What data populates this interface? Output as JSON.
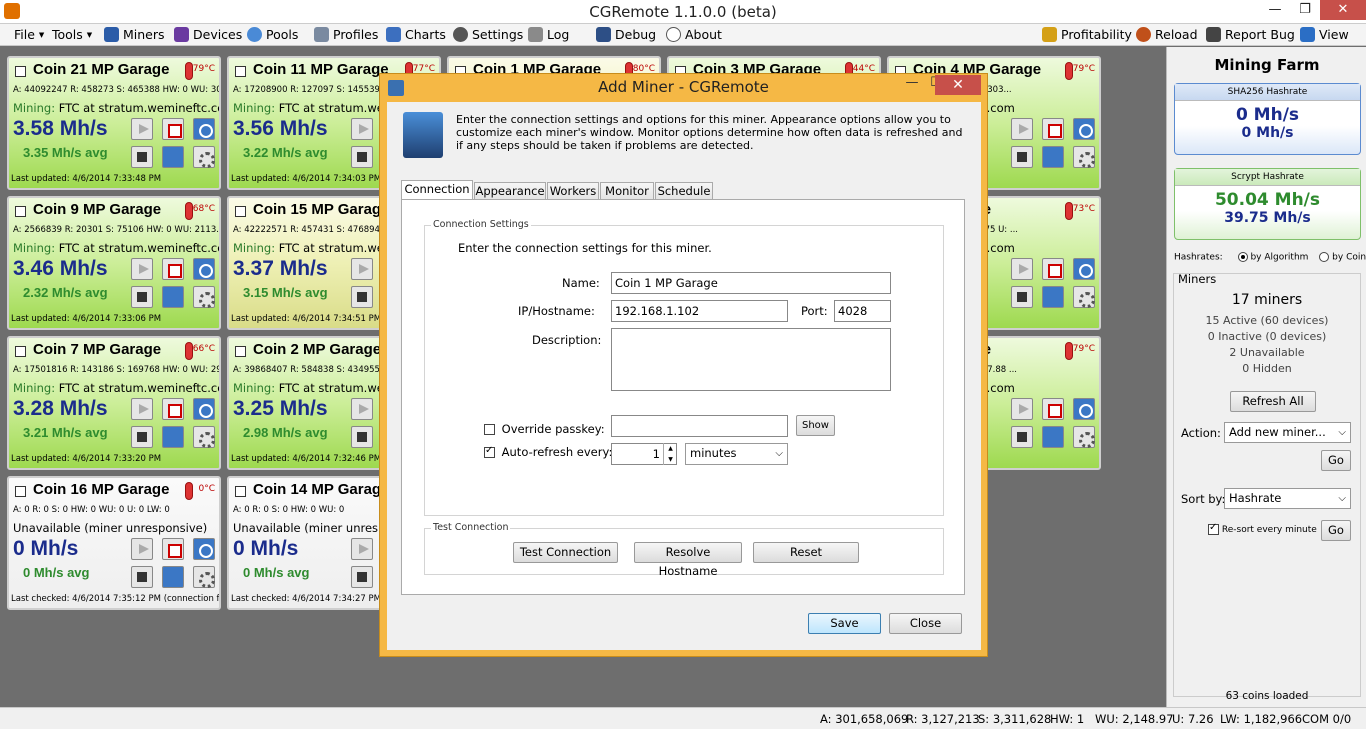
{
  "window": {
    "title": "CGRemote 1.1.0.0 (beta)"
  },
  "menu": [
    {
      "label": "File",
      "caret": true
    },
    {
      "label": "Tools",
      "caret": true
    },
    {
      "label": "Miners",
      "icon": "miners-icon"
    },
    {
      "label": "Devices",
      "icon": "devices-icon"
    },
    {
      "label": "Pools",
      "icon": "pools-icon"
    },
    {
      "label": "Profiles",
      "icon": "profiles-icon"
    },
    {
      "label": "Charts",
      "icon": "charts-icon"
    },
    {
      "label": "Settings",
      "icon": "settings-icon"
    },
    {
      "label": "Log",
      "icon": "log-icon"
    },
    {
      "label": "Debug",
      "icon": "debug-icon"
    },
    {
      "label": "About",
      "icon": "about-icon"
    },
    {
      "label": "Profitability",
      "icon": "profitability-icon"
    },
    {
      "label": "Reload",
      "icon": "reload-icon"
    },
    {
      "label": "Report Bug",
      "icon": "report-bug-icon"
    },
    {
      "label": "View",
      "icon": "view-icon",
      "caret": true
    }
  ],
  "cards": [
    {
      "name": "Coin 21 MP Garage",
      "temp": "79°C",
      "stats": "A: 44092247  R: 458273  S: 465388  HW: 0  WU: 307...",
      "mining_label": "Mining:",
      "mining_value": "FTC at stratum.wemineftc.com",
      "hashrate": "3.58 Mh/s",
      "avg": "3.35 Mh/s avg",
      "updated": "Last updated: 4/6/2014 7:33:48 PM",
      "color": "green"
    },
    {
      "name": "Coin 11 MP Garage",
      "temp": "77°C",
      "stats": "A: 17208900  R: 127097  S: 145539  HW: 0  WU: 3...",
      "mining_label": "Mining:",
      "mining_value": "FTC at stratum.wemineftc.com",
      "hashrate": "3.56 Mh/s",
      "avg": "3.22 Mh/s avg",
      "updated": "Last updated: 4/6/2014 7:34:03 PM",
      "color": "green"
    },
    {
      "name": "Coin 1 MP Garage",
      "temp": "80°C",
      "color": "yellow"
    },
    {
      "name": "Coin 3 MP Garage",
      "temp": "44°C",
      "color": "green"
    },
    {
      "name": "Coin 4 MP Garage",
      "temp": "79°C",
      "stats": "S: 489667  HW: 1  WU: 303...",
      "mining_label": "",
      "mining_value": "atum.wemineftc.com",
      "hashrate": "s",
      "avg": "",
      "updated": ":33:44 PM",
      "color": "green"
    },
    {
      "name": "Coin 9 MP Garage",
      "temp": "68°C",
      "stats": "A: 2566839  R: 20301  S: 75106  HW: 0  WU: 2113.5...",
      "mining_label": "Mining:",
      "mining_value": "FTC at stratum.wemineftc.com",
      "hashrate": "3.46 Mh/s",
      "avg": "2.32 Mh/s avg",
      "updated": "Last updated: 4/6/2014 7:33:06 PM",
      "color": "green"
    },
    {
      "name": "Coin 15 MP Garage",
      "temp": "",
      "stats": "A: 42222571  R: 457431  S: 476894",
      "mining_label": "Mining:",
      "mining_value": "FTC at stratum.wem",
      "hashrate": "3.37 Mh/s",
      "avg": "3.15 Mh/s avg",
      "updated": "Last updated: 4/6/2014 7:34:51 PM",
      "color": "yellow"
    },
    {
      "name": "MP Garage",
      "temp": "73°C",
      "stats": "S: 0  HW: 0  WU: 1021.75  U: ...",
      "mining_label": "",
      "mining_value": "atum.wemineftc.com",
      "hashrate": "s",
      "avg": "",
      "updated": ":33:07 PM",
      "color": "green"
    },
    {
      "name": "Coin 7 MP Garage",
      "temp": "66°C",
      "stats": "A: 17501816  R: 143186  S: 169768  HW: 0  WU: 296...",
      "mining_label": "Mining:",
      "mining_value": "FTC at stratum.wemineftc.com",
      "hashrate": "3.28 Mh/s",
      "avg": "3.21 Mh/s avg",
      "updated": "Last updated: 4/6/2014 7:33:20 PM",
      "color": "green"
    },
    {
      "name": "Coin 2 MP Garage",
      "temp": "",
      "stats": "A: 39868407  R: 584838  S: 434955",
      "mining_label": "Mining:",
      "mining_value": "FTC at stratum.wem",
      "hashrate": "3.25 Mh/s",
      "avg": "2.98 Mh/s avg",
      "updated": "Last updated: 4/6/2014 7:32:46 PM",
      "color": "green"
    },
    {
      "name": "MP Garage",
      "temp": "79°C",
      "stats": "S: 940  HW: 0  WU: 2357.88  ...",
      "mining_label": "",
      "mining_value": "atum.wemineftc.com",
      "hashrate": "s",
      "avg": "",
      "updated": ":34:53 PM",
      "color": "green"
    },
    {
      "name": "Coin 16 MP Garage",
      "temp": "0°C",
      "stats": "A: 0  R: 0  S: 0  HW: 0  WU: 0  U: 0  LW: 0",
      "mining_label": "",
      "mining_value": "Unavailable  (miner unresponsive)",
      "hashrate": "0 Mh/s",
      "avg": "0 Mh/s avg",
      "updated": "Last checked: 4/6/2014 7:35:12 PM (connection fail...",
      "color": "grey"
    },
    {
      "name": "Coin 14 MP Garage",
      "temp": "",
      "stats": "A: 0  R: 0  S: 0  HW: 0  WU: 0",
      "mining_label": "",
      "mining_value": "Unavailable  (miner unresponsive)",
      "hashrate": "0 Mh/s",
      "avg": "0 Mh/s avg",
      "updated": "Last checked: 4/6/2014 7:34:27 PM (conne",
      "color": "grey"
    }
  ],
  "side": {
    "title": "Mining Farm",
    "sha_header": "SHA256 Hashrate",
    "sha_value": "0 Mh/s",
    "sha_avg": "0 Mh/s",
    "scrypt_header": "Scrypt Hashrate",
    "scrypt_value": "50.04 Mh/s",
    "scrypt_avg": "39.75 Mh/s",
    "hashrates_label": "Hashrates:",
    "by_algorithm": "by Algorithm",
    "by_coin": "by Coin",
    "miners_group": "Miners",
    "miners_count": "17 miners",
    "active": "15 Active  (60 devices)",
    "inactive": "0 Inactive  (0 devices)",
    "unavailable": "2 Unavailable",
    "hidden": "0 Hidden",
    "refresh_all": "Refresh All",
    "action_label": "Action:",
    "action_value": "Add new miner...",
    "go": "Go",
    "sort_label": "Sort by:",
    "sort_value": "Hashrate",
    "resort_label": "Re-sort every minute",
    "coins_loaded": "63 coins loaded"
  },
  "status": {
    "a": "A: 301,658,069",
    "r": "R: 3,127,213",
    "s": "S: 3,311,628",
    "hw": "HW: 1",
    "wu": "WU: 2,148.97",
    "u": "U: 7.26",
    "lw": "LW: 1,182,966",
    "com": "COM 0/0"
  },
  "dialog": {
    "title": "Add Miner - CGRemote",
    "intro": "Enter the connection settings and options for this miner. Appearance options allow you to customize each miner's window. Monitor options determine how often data is refreshed and if any steps should be taken if problems are detected.",
    "tabs": [
      "Connection",
      "Appearance",
      "Workers",
      "Monitor",
      "Schedule"
    ],
    "conn_group": "Connection Settings",
    "conn_intro": "Enter the connection settings for this miner.",
    "name_label": "Name:",
    "name_value": "Coin 1 MP Garage",
    "ip_label": "IP/Hostname:",
    "ip_value": "192.168.1.102",
    "port_label": "Port:",
    "port_value": "4028",
    "desc_label": "Description:",
    "passkey_label": "Override passkey:",
    "show_btn": "Show",
    "refresh_label": "Auto-refresh every:",
    "refresh_value": "1",
    "refresh_unit": "minutes",
    "test_group": "Test Connection",
    "test_btn": "Test Connection",
    "resolve_btn": "Resolve Hostname",
    "reset_btn": "Reset",
    "save_btn": "Save",
    "close_btn": "Close"
  }
}
